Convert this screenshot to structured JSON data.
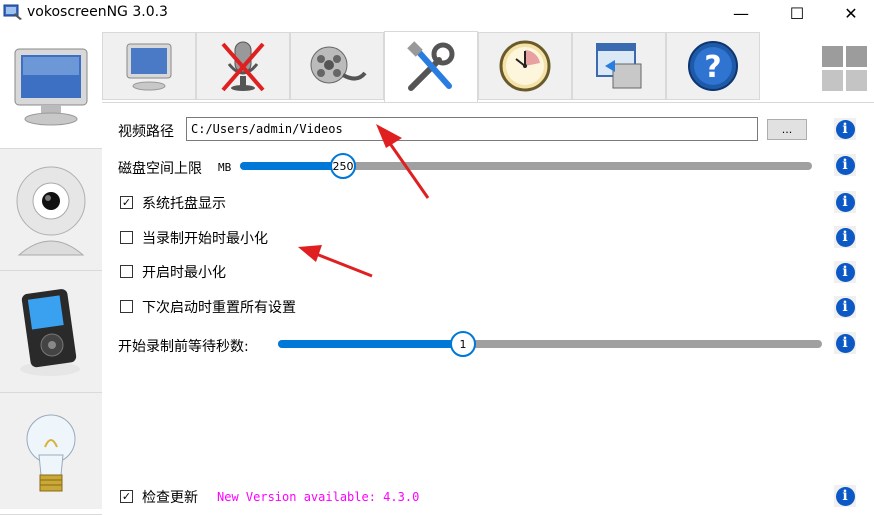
{
  "window": {
    "title": "vokoscreenNG 3.0.3",
    "minimize": "—",
    "maximize": "☐",
    "close": "✕"
  },
  "sidebar": {
    "items": [
      {
        "name": "screen",
        "icon": "monitor-icon"
      },
      {
        "name": "webcam",
        "icon": "webcam-icon"
      },
      {
        "name": "player",
        "icon": "media-player-icon"
      },
      {
        "name": "about",
        "icon": "lightbulb-icon"
      }
    ]
  },
  "tabs": [
    {
      "icon": "monitor-icon"
    },
    {
      "icon": "muted-microphone-icon"
    },
    {
      "icon": "film-reel-icon"
    },
    {
      "icon": "tools-icon",
      "active": true
    },
    {
      "icon": "clock-icon"
    },
    {
      "icon": "window-export-icon"
    },
    {
      "icon": "help-icon"
    }
  ],
  "settings": {
    "video_path_label": "视频路径",
    "video_path_value": "C:/Users/admin/Videos",
    "browse_label": "...",
    "disk_space_label": "磁盘空间上限",
    "disk_space_unit": "MB",
    "disk_space_value": "250",
    "disk_space_fraction": 0.18,
    "tray_label": "系统托盘显示",
    "tray_checked": true,
    "minimize_on_record_label": "当录制开始时最小化",
    "minimize_on_record_checked": false,
    "minimize_on_start_label": "开启时最小化",
    "minimize_on_start_checked": false,
    "reset_label": "下次启动时重置所有设置",
    "reset_checked": false,
    "countdown_label": "开始录制前等待秒数:",
    "countdown_value": "1",
    "countdown_fraction": 0.34,
    "check_update_label": "检查更新",
    "check_update_checked": true,
    "new_version_text": "New Version available: 4.3.0"
  },
  "colors": {
    "accent": "#0078d7",
    "info": "#0c58c4",
    "new_version": "#ff00ff",
    "arrow": "#e02020"
  }
}
